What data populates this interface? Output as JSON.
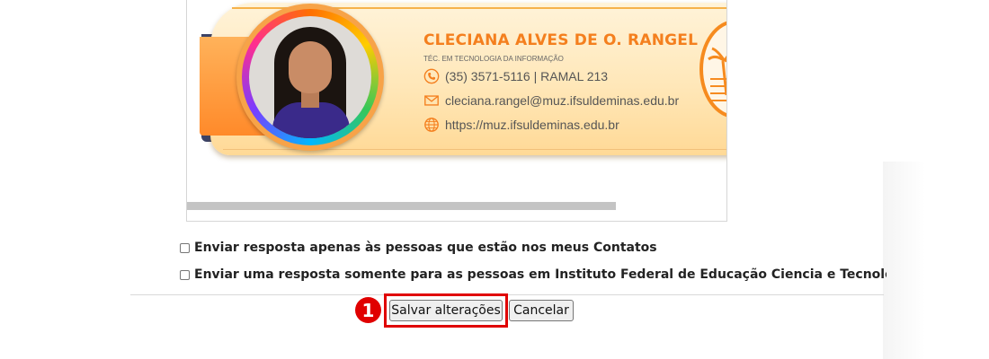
{
  "signature": {
    "name": "CLECIANA ALVES DE O. RANGEL",
    "role": "TÉC. EM TECNOLOGIA DA INFORMAÇÃO",
    "phone": "(35) 3571-5116 | RAMAL 213",
    "email": "cleciana.rangel@muz.ifsuldeminas.edu.br",
    "website": "https://muz.ifsuldeminas.edu.br",
    "colors": {
      "accent": "#f47f1e",
      "banner": "#ffe7b8",
      "shadow": "#3c4366"
    },
    "icons": {
      "phone": "phone-icon",
      "email": "envelope-icon",
      "website": "globe-icon"
    }
  },
  "options": {
    "contacts_only_label": "Enviar resposta apenas às pessoas que estão nos meus Contatos",
    "contacts_only_checked": false,
    "org_only_label": "Enviar uma resposta somente para as pessoas em Instituto Federal de Educação Ciencia e Tecnologia do Sul de Minas",
    "org_only_checked": false
  },
  "actions": {
    "save_label": "Salvar alterações",
    "cancel_label": "Cancelar"
  },
  "annotation": {
    "step": "1",
    "color": "#e00000"
  }
}
